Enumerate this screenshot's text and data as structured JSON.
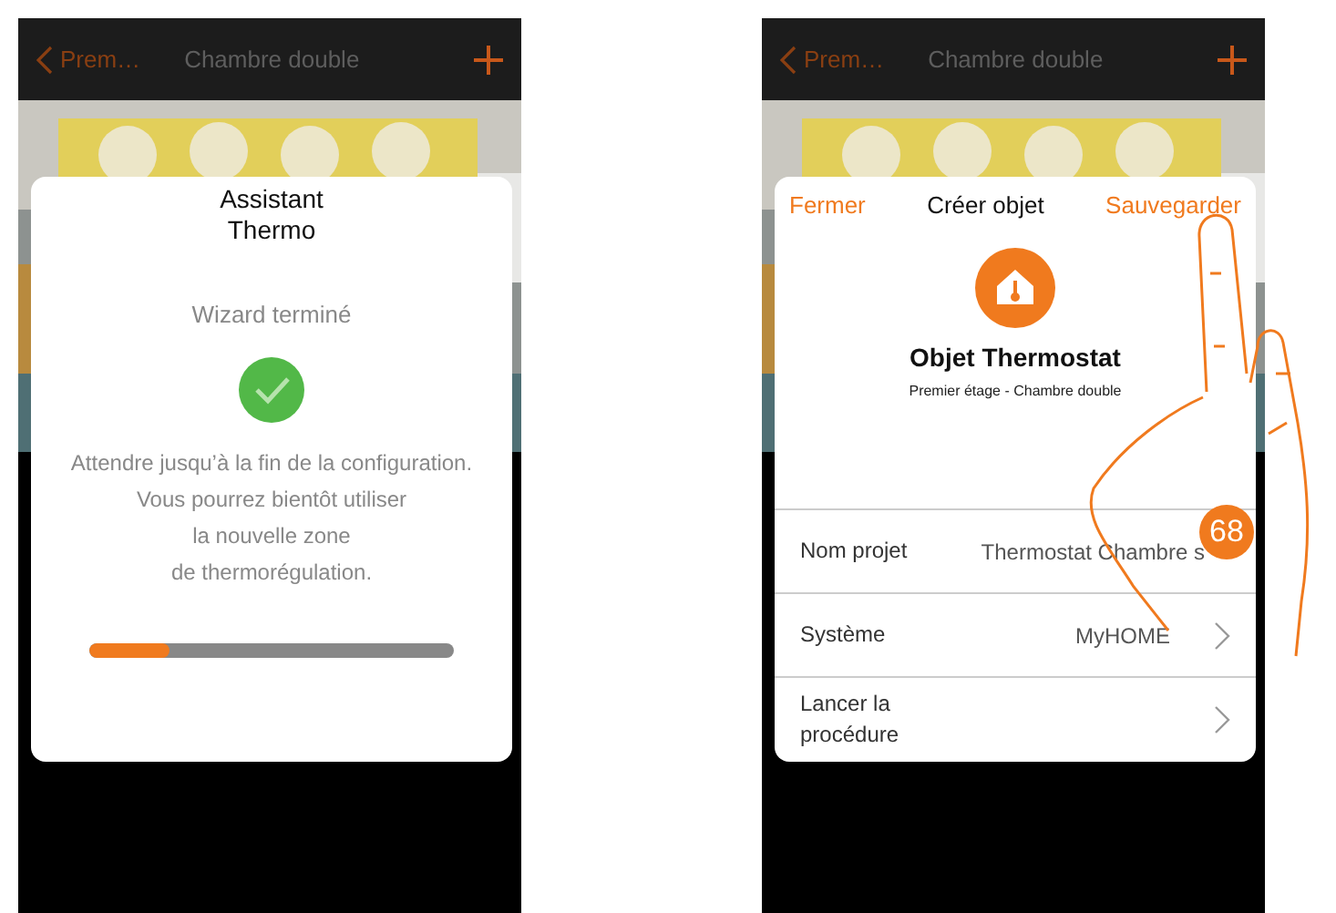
{
  "screens": [
    {
      "kind": "wizard",
      "header": {
        "back": "Prem…",
        "title": "Chambre double"
      },
      "modal": {
        "title": "Assistant Thermo",
        "status": "Wizard terminé",
        "message": [
          "Attendre jusqu’à la fin de la configuration.",
          "Vous pourrez bientôt utiliser",
          "la nouvelle zone",
          "de thermorégulation."
        ],
        "level": 0.22
      }
    },
    {
      "kind": "form",
      "header": {
        "back": "Prem…",
        "title": "Chambre double"
      },
      "modal": {
        "close": "Fermer",
        "title": "Créer objet",
        "save": "Sauvegarder",
        "object": "Objet Thermostat",
        "location": "Premier étage - Chambre double",
        "rows": [
          {
            "label": "Nom projet",
            "value": "Thermostat Chambre s",
            "chevron": false
          },
          {
            "label": "Système",
            "value": "MyHOME",
            "chevron": true
          },
          {
            "label": "Lancer la procédure",
            "chevron": true
          }
        ]
      }
    }
  ],
  "badge": "68"
}
